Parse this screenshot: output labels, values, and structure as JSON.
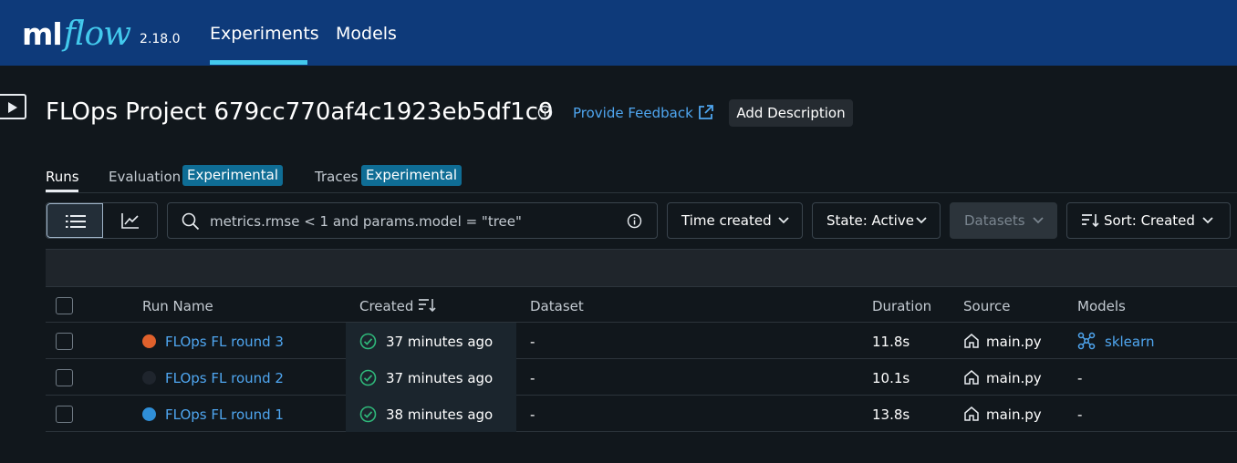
{
  "header": {
    "logo_ml": "ml",
    "logo_flow": "flow",
    "version": "2.18.0",
    "nav": [
      {
        "label": "Experiments",
        "active": true
      },
      {
        "label": "Models",
        "active": false
      }
    ]
  },
  "experiment": {
    "title": "FLOps Project 679cc770af4c1923eb5df1c9",
    "feedback_link": "Provide Feedback",
    "add_description": "Add Description"
  },
  "tabs": [
    {
      "label": "Runs",
      "active": true
    },
    {
      "label": "Evaluation",
      "badge": "Experimental"
    },
    {
      "label": "Traces",
      "badge": "Experimental"
    }
  ],
  "toolbar": {
    "search_value": "metrics.rmse < 1 and params.model = \"tree\"",
    "time_filter": "Time created",
    "state_filter": "State: Active",
    "datasets": "Datasets",
    "sort": "Sort: Created"
  },
  "table": {
    "columns": [
      "Run Name",
      "Created",
      "Dataset",
      "Duration",
      "Source",
      "Models"
    ],
    "rows": [
      {
        "name": "FLOps FL round 3",
        "color": "#e0612c",
        "created": "37 minutes ago",
        "dataset": "-",
        "duration": "11.8s",
        "source": "main.py",
        "model": "sklearn"
      },
      {
        "name": "FLOps FL round 2",
        "color": "#1f252d",
        "created": "37 minutes ago",
        "dataset": "-",
        "duration": "10.1s",
        "source": "main.py",
        "model": "-"
      },
      {
        "name": "FLOps FL round 1",
        "color": "#2f8fd8",
        "created": "38 minutes ago",
        "dataset": "-",
        "duration": "13.8s",
        "source": "main.py",
        "model": "-"
      }
    ]
  },
  "colors": {
    "header_bg": "#0e3a7a",
    "accent": "#43c9ed",
    "link": "#4fa6f0",
    "badge": "#0f6d95",
    "success": "#2fb87a"
  }
}
